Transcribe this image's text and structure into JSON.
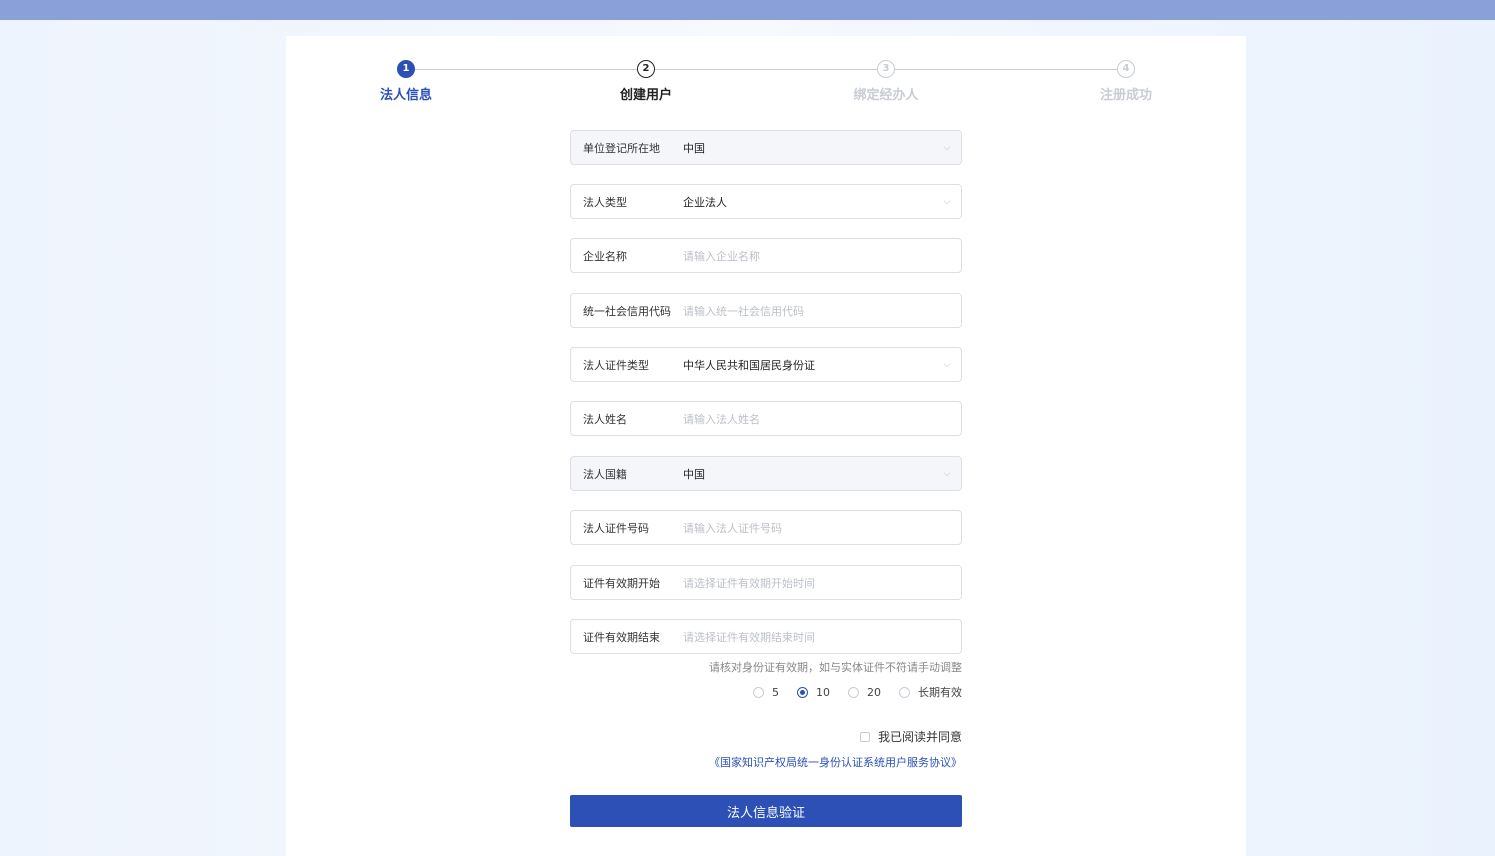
{
  "steps": [
    {
      "number": "1",
      "label": "法人信息",
      "state": "active"
    },
    {
      "number": "2",
      "label": "创建用户",
      "state": "current"
    },
    {
      "number": "3",
      "label": "绑定经办人",
      "state": "pending"
    },
    {
      "number": "4",
      "label": "注册成功",
      "state": "pending"
    }
  ],
  "form": {
    "region": {
      "label": "单位登记所在地",
      "value": "中国"
    },
    "entity_type": {
      "label": "法人类型",
      "value": "企业法人"
    },
    "company_name": {
      "label": "企业名称",
      "placeholder": "请输入企业名称"
    },
    "credit_code": {
      "label": "统一社会信用代码",
      "placeholder": "请输入统一社会信用代码"
    },
    "id_type": {
      "label": "法人证件类型",
      "value": "中华人民共和国居民身份证"
    },
    "legal_name": {
      "label": "法人姓名",
      "placeholder": "请输入法人姓名"
    },
    "nationality": {
      "label": "法人国籍",
      "value": "中国"
    },
    "id_number": {
      "label": "法人证件号码",
      "placeholder": "请输入法人证件号码"
    },
    "valid_start": {
      "label": "证件有效期开始",
      "placeholder": "请选择证件有效期开始时间"
    },
    "valid_end": {
      "label": "证件有效期结束",
      "placeholder": "请选择证件有效期结束时间"
    }
  },
  "validity": {
    "hint": "请核对身份证有效期，如与实体证件不符请手动调整",
    "options": [
      {
        "label": "5",
        "checked": false
      },
      {
        "label": "10",
        "checked": true
      },
      {
        "label": "20",
        "checked": false
      },
      {
        "label": "长期有效",
        "checked": false
      }
    ]
  },
  "agreement": {
    "checkbox_label": "我已阅读并同意",
    "link_text": "《国家知识产权局统一身份认证系统用户服务协议》"
  },
  "submit_label": "法人信息验证",
  "colors": {
    "primary": "#2c50b6",
    "topbar": "#8aa0d8"
  }
}
